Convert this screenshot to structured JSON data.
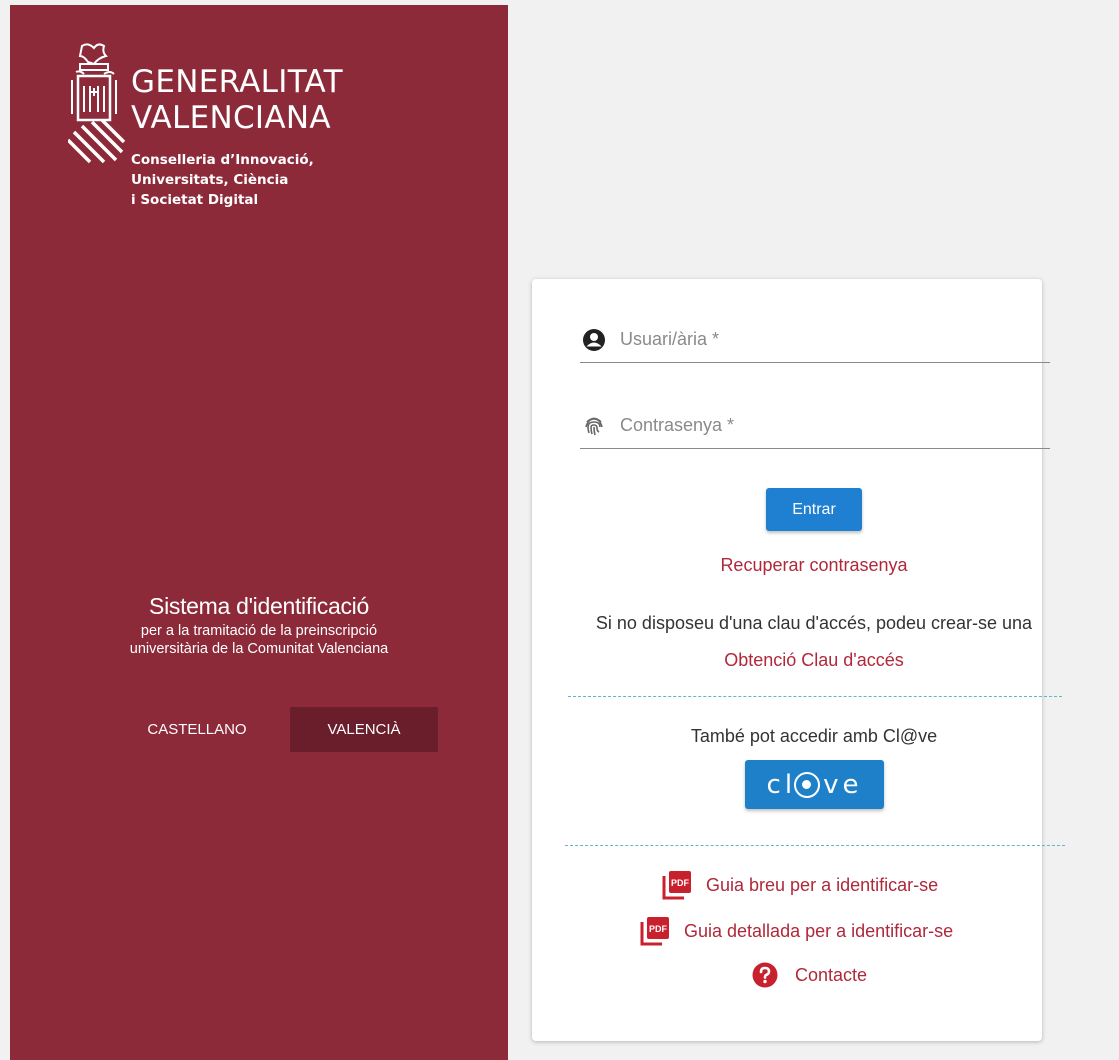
{
  "branding": {
    "title_line1": "GENERALITAT",
    "title_line2": "VALENCIANA",
    "department_line1": "Conselleria d’Innovació,",
    "department_line2": "Universitats, Ciència",
    "department_line3": "i Societat Digital"
  },
  "system": {
    "title": "Sistema d'identificació",
    "subtitle_line1": "per a la tramitació de la preinscripció",
    "subtitle_line2": "universitària de la Comunitat Valenciana"
  },
  "languages": {
    "castellano": "CASTELLANO",
    "valencia": "VALENCIÀ",
    "selected": "VALENCIÀ"
  },
  "login": {
    "username_placeholder": "Usuari/ària *",
    "username_value": "",
    "password_placeholder": "Contrasenya *",
    "password_value": "",
    "submit_label": "Entrar",
    "recover_label": "Recuperar contrasenya",
    "no_key_text": "Si no disposeu d'una clau d'accés, podeu crear-se una",
    "obtain_key_label": "Obtenció Clau d'accés"
  },
  "clave": {
    "prompt": "També pot accedir amb Cl@ve",
    "button_left": "cl",
    "button_right": "ve"
  },
  "help": {
    "guide_short": "Guia breu per a identificar-se",
    "guide_detailed": "Guia detallada per a identificar-se",
    "contact": "Contacte",
    "pdf_badge": "PDF"
  },
  "colors": {
    "brand_red": "#8d2a3a",
    "brand_red_dark": "#6a1e2b",
    "link_red": "#b0283b",
    "primary_blue": "#1f7fd1",
    "divider_teal": "#5fb5c9"
  },
  "icons": {
    "username": "account-circle-icon",
    "password": "fingerprint-icon",
    "guide": "pdf-file-icon",
    "contact": "help-circle-icon"
  }
}
